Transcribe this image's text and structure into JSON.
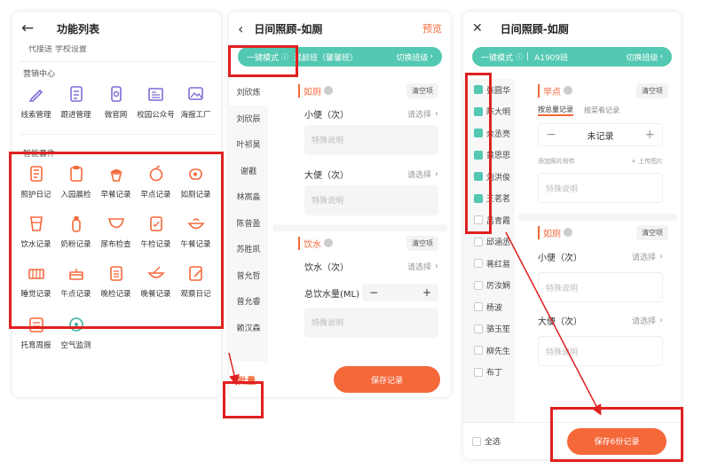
{
  "panel1": {
    "title": "功能列表",
    "cut_text": "代接送   学校设置",
    "marketing_title": "营销中心",
    "marketing_items": [
      {
        "label": "线索管理",
        "icon": "pencil-icon"
      },
      {
        "label": "跟进管理",
        "icon": "checklist-icon"
      },
      {
        "label": "微官网",
        "icon": "phone-icon"
      },
      {
        "label": "校园公众号",
        "icon": "newspaper-icon"
      },
      {
        "label": "海报工厂",
        "icon": "image-edit-icon"
      }
    ],
    "smart_title": "智能套件",
    "smart_items": [
      {
        "label": "照护日记",
        "icon": "notebook-icon"
      },
      {
        "label": "入园晨检",
        "icon": "clipboard-icon"
      },
      {
        "label": "早餐记录",
        "icon": "cupcake-icon"
      },
      {
        "label": "早点记录",
        "icon": "apple-icon"
      },
      {
        "label": "如厕记录",
        "icon": "toilet-roll-icon"
      },
      {
        "label": "饮水记录",
        "icon": "cup-icon"
      },
      {
        "label": "奶粉记录",
        "icon": "bottle-icon"
      },
      {
        "label": "尿布检查",
        "icon": "diaper-icon"
      },
      {
        "label": "午检记录",
        "icon": "clipboard-check-icon"
      },
      {
        "label": "午餐记录",
        "icon": "bowl-icon"
      },
      {
        "label": "睡觉记录",
        "icon": "crib-icon"
      },
      {
        "label": "午点记录",
        "icon": "cake-icon"
      },
      {
        "label": "晚检记录",
        "icon": "clipboard-list-icon"
      },
      {
        "label": "晚餐记录",
        "icon": "soup-bowl-icon"
      },
      {
        "label": "观察日记",
        "icon": "edit-note-icon"
      }
    ],
    "extra_items": [
      {
        "label": "托育周报",
        "icon": "weekly-report-icon"
      },
      {
        "label": "空气监测",
        "icon": "air-monitor-icon"
      }
    ]
  },
  "panel2": {
    "title": "日间照顾-如厕",
    "preview": "预览",
    "mode": "一键模式",
    "class_name": "混龄班（馨馨班）",
    "switch_class": "切换班级",
    "students": [
      "刘欣炼",
      "刘欣辰",
      "叶祁昊",
      "谢戳",
      "林嵩淼",
      "陈曾盈",
      "苏胜凯",
      "曾允哲",
      "曾允睿",
      "赖汉森"
    ],
    "toilet_title": "如厕",
    "clear": "清空项",
    "pee_label": "小便（次）",
    "poop_label": "大便（次）",
    "select_placeholder": "请选择",
    "note_placeholder": "特殊说明",
    "water_title": "饮水",
    "water_label": "饮水（次）",
    "total_water_label": "总饮水量(ML)",
    "batch": "批量",
    "save": "保存记录"
  },
  "panel3": {
    "title": "日间照顾-如厕",
    "mode": "一键模式",
    "class_name": "A1909班",
    "switch_class": "切换班级",
    "students": [
      {
        "name": "张圆华",
        "checked": true
      },
      {
        "name": "陈大明",
        "checked": true
      },
      {
        "name": "余丞亮",
        "checked": true
      },
      {
        "name": "黄思思",
        "checked": true
      },
      {
        "name": "刘洪俊",
        "checked": true
      },
      {
        "name": "王茗茗",
        "checked": true
      },
      {
        "name": "吕青霞",
        "checked": false
      },
      {
        "name": "邱涵丞",
        "checked": false
      },
      {
        "name": "蒋红易",
        "checked": false
      },
      {
        "name": "厉汝娴",
        "checked": false
      },
      {
        "name": "杨波",
        "checked": false
      },
      {
        "name": "骆玉笙",
        "checked": false
      },
      {
        "name": "柳先生",
        "checked": false
      },
      {
        "name": "布丁",
        "checked": false
      }
    ],
    "snack_title": "早点",
    "clear": "清空项",
    "tab_total": "按总量记录",
    "tab_dish": "按菜肴记录",
    "counter_value": "未记录",
    "attach_label": "添加照片附件",
    "upload": "+ 上传图片",
    "note_placeholder": "特殊说明",
    "toilet_title": "如厕",
    "pee_label": "小便（次）",
    "poop_label": "大便（次）",
    "select_placeholder": "请选择",
    "select_all": "全选",
    "save": "保存6份记录"
  },
  "colors": {
    "accent": "#f5683a",
    "teal": "#53c8b2",
    "highlight": "#e02020"
  }
}
